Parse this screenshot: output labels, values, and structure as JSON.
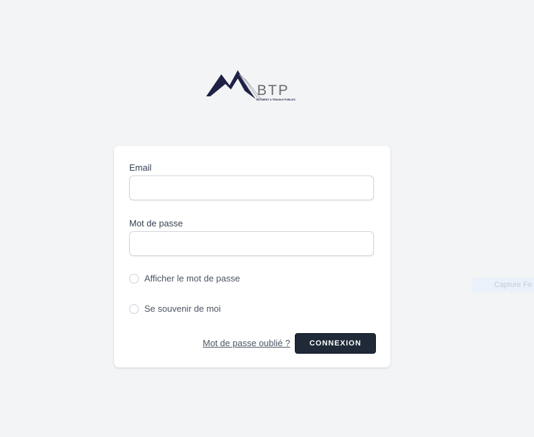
{
  "logo": {
    "text": "BTP",
    "subtitle": "BÂTIMENT & TRAVAUX PUBLICS",
    "colors": {
      "mountain": "#1e2145",
      "text": "#6b6b6b"
    }
  },
  "form": {
    "email_label": "Email",
    "email_value": "",
    "password_label": "Mot de passe",
    "password_value": "",
    "show_password_label": "Afficher le mot de passe",
    "remember_me_label": "Se souvenir de moi",
    "forgot_password_link": "Mot de passe oublié ?",
    "submit_label": "CONNEXION"
  },
  "overlay": {
    "capture_text": "Capture Fe"
  },
  "colors": {
    "background": "#f3f4f6",
    "card": "#ffffff",
    "button": "#1f2937"
  }
}
